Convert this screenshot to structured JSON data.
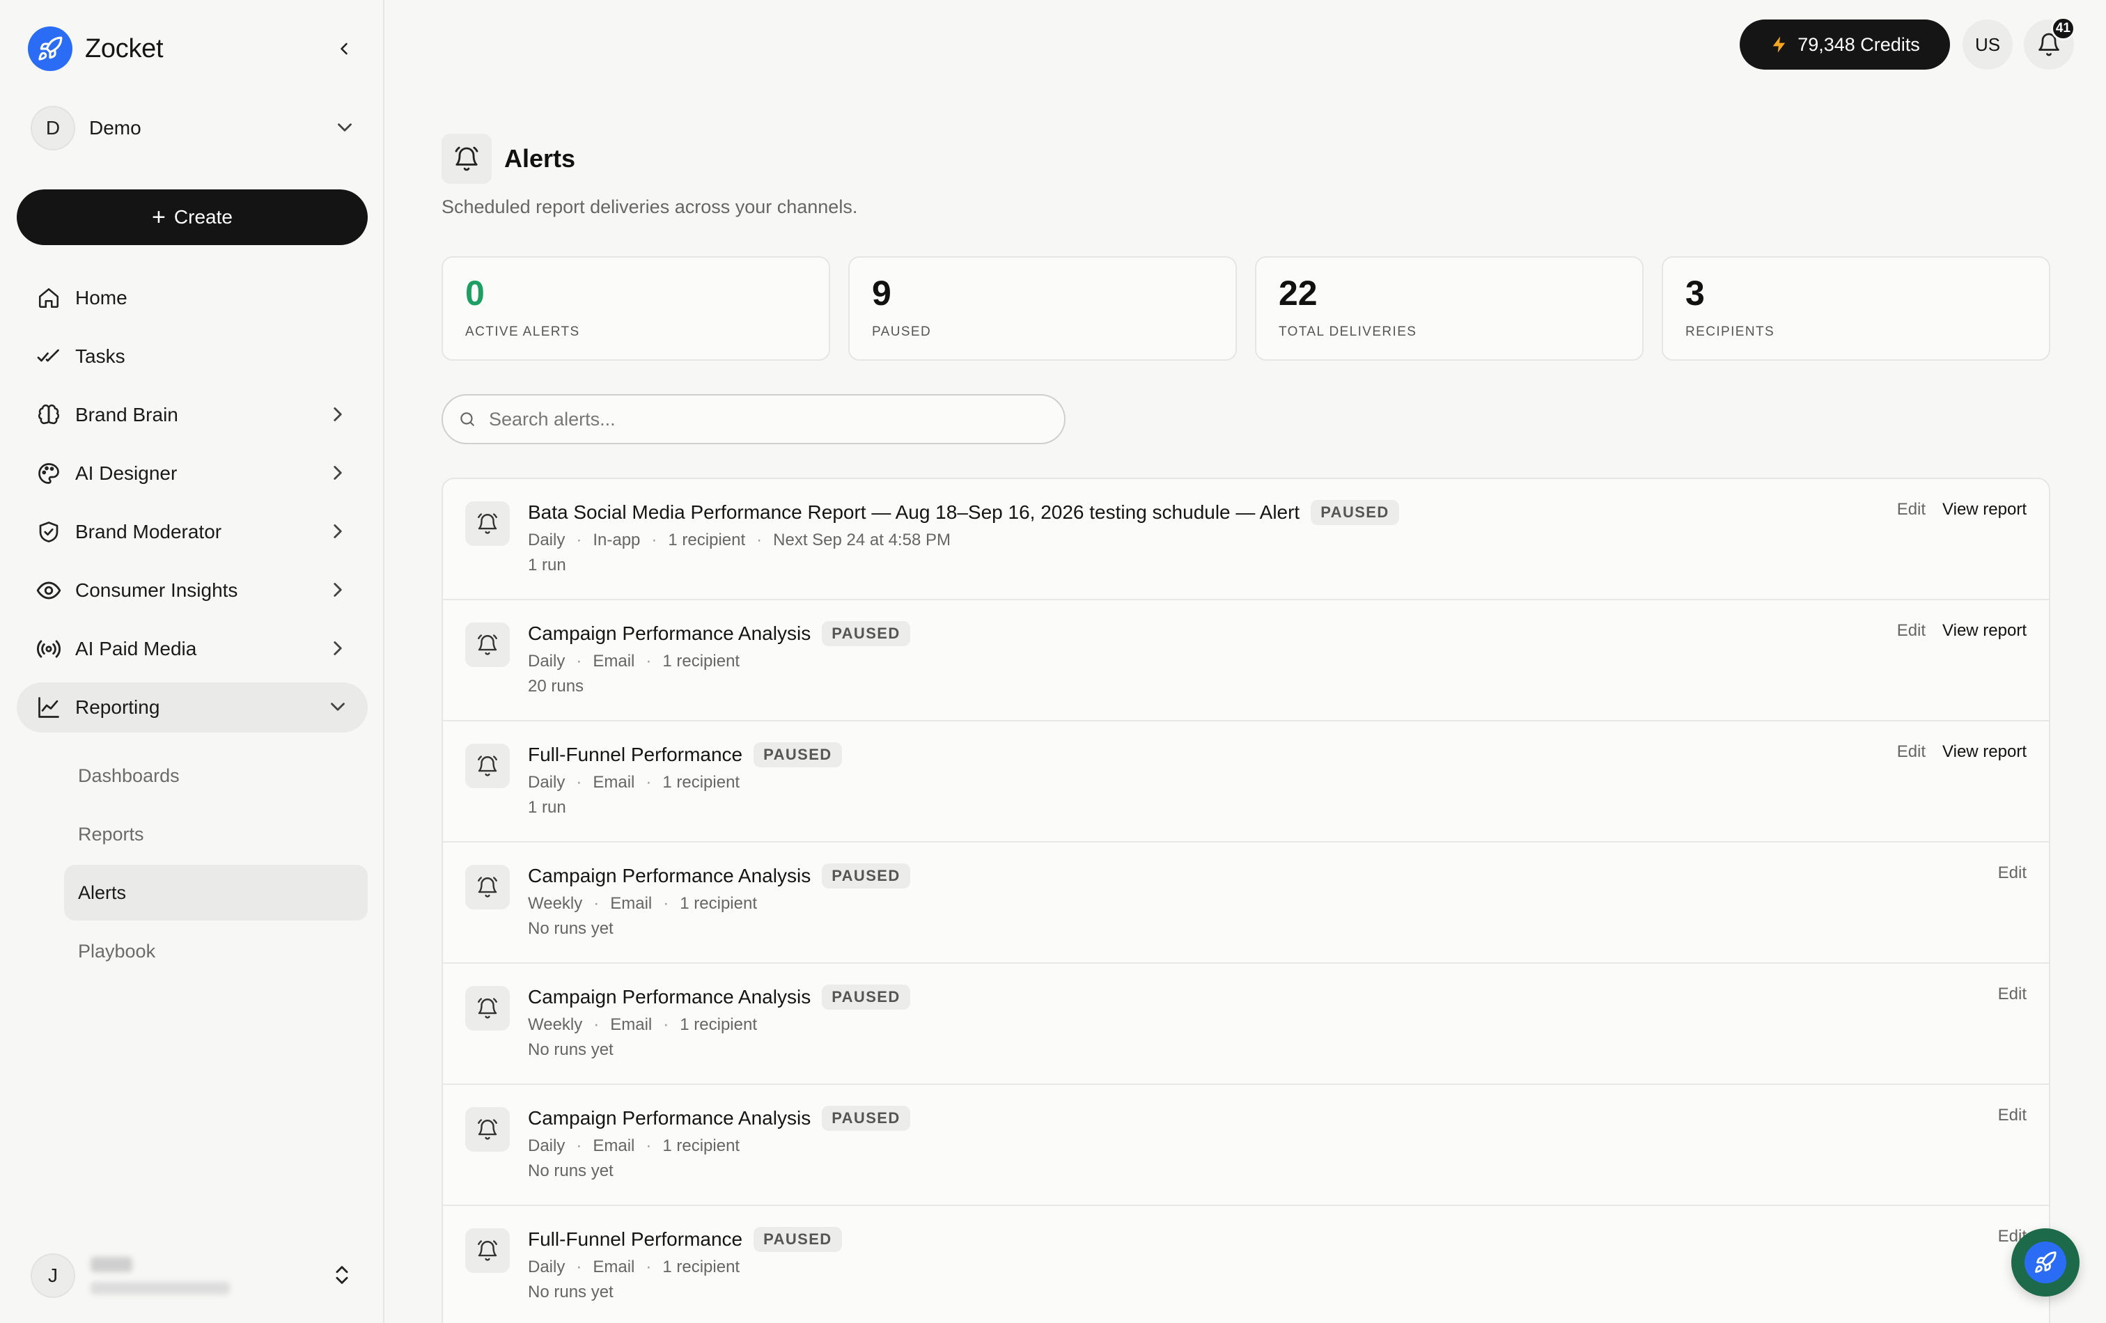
{
  "brand": {
    "name": "Zocket"
  },
  "workspace": {
    "initial": "D",
    "name": "Demo"
  },
  "create_label": "Create",
  "nav": [
    {
      "label": "Home",
      "icon": "home-icon"
    },
    {
      "label": "Tasks",
      "icon": "tasks-icon"
    },
    {
      "label": "Brand Brain",
      "icon": "brain-icon"
    },
    {
      "label": "AI Designer",
      "icon": "palette-icon"
    },
    {
      "label": "Brand Moderator",
      "icon": "shield-icon"
    },
    {
      "label": "Consumer Insights",
      "icon": "eye-icon"
    },
    {
      "label": "AI Paid Media",
      "icon": "broadcast-icon"
    },
    {
      "label": "Reporting",
      "icon": "chart-line-icon"
    }
  ],
  "subnav": [
    {
      "label": "Dashboards"
    },
    {
      "label": "Reports"
    },
    {
      "label": "Alerts"
    },
    {
      "label": "Playbook"
    }
  ],
  "user": {
    "initial": "J"
  },
  "topbar": {
    "credits": "79,348 Credits",
    "account": "US",
    "notifications": "41"
  },
  "page": {
    "title": "Alerts",
    "subtitle": "Scheduled report deliveries across your channels."
  },
  "stats": [
    {
      "value": "0",
      "label": "ACTIVE ALERTS"
    },
    {
      "value": "9",
      "label": "PAUSED"
    },
    {
      "value": "22",
      "label": "TOTAL DELIVERIES"
    },
    {
      "value": "3",
      "label": "RECIPIENTS"
    }
  ],
  "search": {
    "placeholder": "Search alerts..."
  },
  "actions": {
    "edit": "Edit",
    "view": "View report"
  },
  "alerts": [
    {
      "title": "Bata Social Media Performance Report — Aug 18–Sep 16, 2026 testing schudule — Alert",
      "status": "PAUSED",
      "meta": [
        "Daily",
        "In-app",
        "1 recipient",
        "Next Sep 24 at 4:58 PM"
      ],
      "runs": "1 run"
    },
    {
      "title": "Campaign Performance Analysis",
      "status": "PAUSED",
      "meta": [
        "Daily",
        "Email",
        "1 recipient"
      ],
      "runs": "20 runs"
    },
    {
      "title": "Full-Funnel Performance",
      "status": "PAUSED",
      "meta": [
        "Daily",
        "Email",
        "1 recipient"
      ],
      "runs": "1 run"
    },
    {
      "title": "Campaign Performance Analysis",
      "status": "PAUSED",
      "meta": [
        "Weekly",
        "Email",
        "1 recipient"
      ],
      "runs": "No runs yet"
    },
    {
      "title": "Campaign Performance Analysis",
      "status": "PAUSED",
      "meta": [
        "Weekly",
        "Email",
        "1 recipient"
      ],
      "runs": "No runs yet"
    },
    {
      "title": "Campaign Performance Analysis",
      "status": "PAUSED",
      "meta": [
        "Daily",
        "Email",
        "1 recipient"
      ],
      "runs": "No runs yet"
    },
    {
      "title": "Full-Funnel Performance",
      "status": "PAUSED",
      "meta": [
        "Daily",
        "Email",
        "1 recipient"
      ],
      "runs": "No runs yet"
    }
  ],
  "colors": {
    "accent_green": "#1f9e63",
    "brand_blue": "#2b6cf5",
    "dark": "#141414"
  }
}
